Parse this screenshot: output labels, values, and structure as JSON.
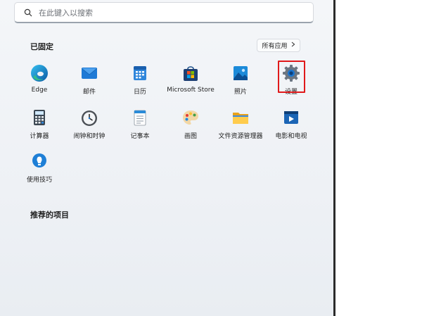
{
  "search": {
    "placeholder": "在此键入以搜索"
  },
  "pinned": {
    "title": "已固定",
    "all_apps_label": "所有应用",
    "apps": [
      {
        "label": "Edge",
        "icon": "edge-icon"
      },
      {
        "label": "邮件",
        "icon": "mail-icon"
      },
      {
        "label": "日历",
        "icon": "calendar-icon"
      },
      {
        "label": "Microsoft Store",
        "icon": "store-icon"
      },
      {
        "label": "照片",
        "icon": "photos-icon"
      },
      {
        "label": "设置",
        "icon": "settings-icon"
      },
      {
        "label": "计算器",
        "icon": "calculator-icon"
      },
      {
        "label": "闹钟和时钟",
        "icon": "clock-icon"
      },
      {
        "label": "记事本",
        "icon": "notepad-icon"
      },
      {
        "label": "画图",
        "icon": "paint-icon"
      },
      {
        "label": "文件资源管理器",
        "icon": "file-explorer-icon"
      },
      {
        "label": "电影和电视",
        "icon": "movies-tv-icon"
      },
      {
        "label": "使用技巧",
        "icon": "tips-icon"
      }
    ]
  },
  "recommended": {
    "title": "推荐的项目"
  },
  "colors": {
    "highlight": "#e0191a",
    "accent": "#0a64d2"
  }
}
